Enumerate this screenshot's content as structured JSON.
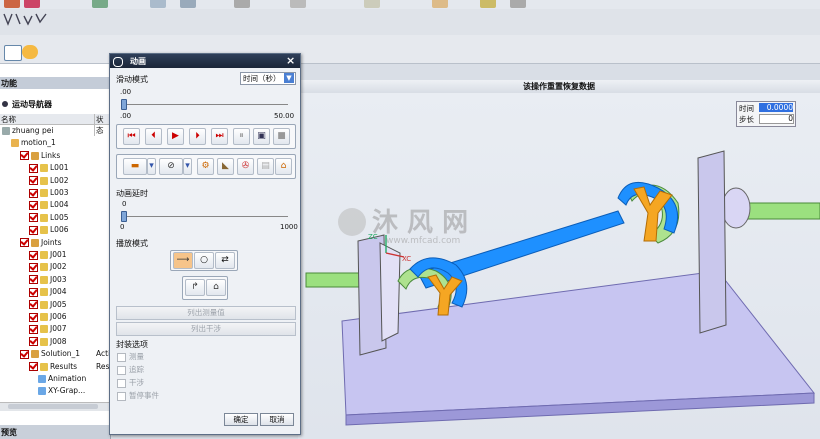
{
  "toolbar": {
    "filter_label": "功能"
  },
  "navigator": {
    "title": "运动导航器",
    "col_name": "名称",
    "col_status": "状态",
    "rows": [
      {
        "label": "zhuang pei",
        "status": "",
        "level": 0
      },
      {
        "label": "motion_1",
        "status": "",
        "level": 1
      },
      {
        "label": "Links",
        "status": "",
        "level": 2
      },
      {
        "label": "L001",
        "status": "",
        "level": 3
      },
      {
        "label": "L002",
        "status": "",
        "level": 3
      },
      {
        "label": "L003",
        "status": "",
        "level": 3
      },
      {
        "label": "L004",
        "status": "",
        "level": 3
      },
      {
        "label": "L005",
        "status": "",
        "level": 3
      },
      {
        "label": "L006",
        "status": "",
        "level": 3
      },
      {
        "label": "Joints",
        "status": "",
        "level": 2
      },
      {
        "label": "J001",
        "status": "",
        "level": 3
      },
      {
        "label": "J002",
        "status": "",
        "level": 3
      },
      {
        "label": "J003",
        "status": "",
        "level": 3
      },
      {
        "label": "J004",
        "status": "",
        "level": 3
      },
      {
        "label": "J005",
        "status": "",
        "level": 3
      },
      {
        "label": "J006",
        "status": "",
        "level": 3
      },
      {
        "label": "J007",
        "status": "",
        "level": 3
      },
      {
        "label": "J008",
        "status": "",
        "level": 3
      },
      {
        "label": "Solution_1",
        "status": "Acti",
        "level": 2
      },
      {
        "label": "Results",
        "status": "Resu",
        "level": 3
      },
      {
        "label": "Animation",
        "status": "",
        "level": 4
      },
      {
        "label": "XY-Grap...",
        "status": "",
        "level": 4
      }
    ],
    "footer": "预览"
  },
  "viewport": {
    "banner": "该操作重置恢复数据",
    "time_label": "时间",
    "time_value": "0.0000",
    "step_label": "步长",
    "step_value": "0",
    "watermark": "沐 风 网",
    "watermark_url": "www.mfcad.com",
    "axis_z": "ZC",
    "axis_x": "XC"
  },
  "dialog": {
    "title": "动画",
    "mode_label": "滑动模式",
    "mode_value": "时间（秒）",
    "slider1_current": ".00",
    "slider1_min": ".00",
    "slider1_max": "50.00",
    "delay_label": "动画延时",
    "delay_current": "0",
    "delay_min": "0",
    "delay_max": "1000",
    "play_mode_label": "播放模式",
    "list_measure_btn": "列出测量值",
    "list_interference_btn": "列出干涉",
    "envelope_label": "封装选项",
    "options": [
      "测量",
      "追踪",
      "干涉",
      "暂停事件"
    ],
    "ok": "确定",
    "cancel": "取消"
  },
  "colors": {
    "accent": "#1e90ff",
    "green": "#8fd67a",
    "orange": "#f5a623",
    "plate": "#c8c6f2"
  }
}
